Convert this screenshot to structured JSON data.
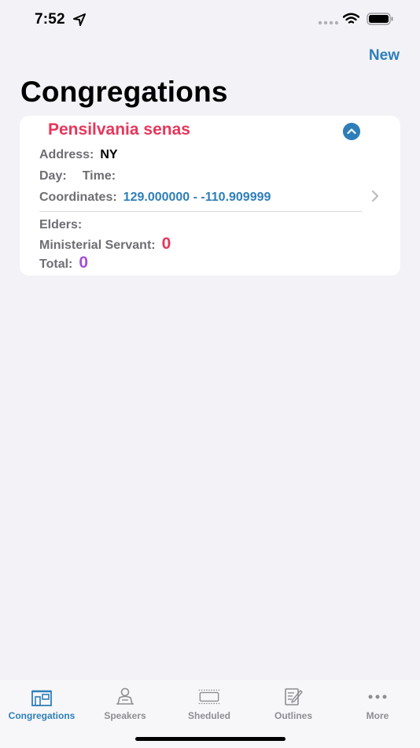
{
  "status_bar": {
    "time": "7:52"
  },
  "nav": {
    "new_label": "New",
    "title": "Congregations"
  },
  "congregation": {
    "name": "Pensilvania senas",
    "address_label": "Address:",
    "address_value": "NY",
    "day_label": "Day:",
    "time_label": "Time:",
    "coordinates_label": "Coordinates:",
    "coordinates_value": "129.000000 - -110.909999",
    "elders_label": "Elders:",
    "ministerial_label": "Ministerial Servant:",
    "ministerial_value": "0",
    "total_label": "Total:",
    "total_value": "0"
  },
  "colors": {
    "accent": "#2e7fb9",
    "name_red": "#e8365b",
    "total_purple": "#a350d6"
  },
  "tabs": [
    {
      "label": "Congregations",
      "icon": "building-icon",
      "active": true
    },
    {
      "label": "Speakers",
      "icon": "speaker-icon",
      "active": false
    },
    {
      "label": "Sheduled",
      "icon": "schedule-icon",
      "active": false
    },
    {
      "label": "Outlines",
      "icon": "outline-icon",
      "active": false
    },
    {
      "label": "More",
      "icon": "more-icon",
      "active": false
    }
  ]
}
